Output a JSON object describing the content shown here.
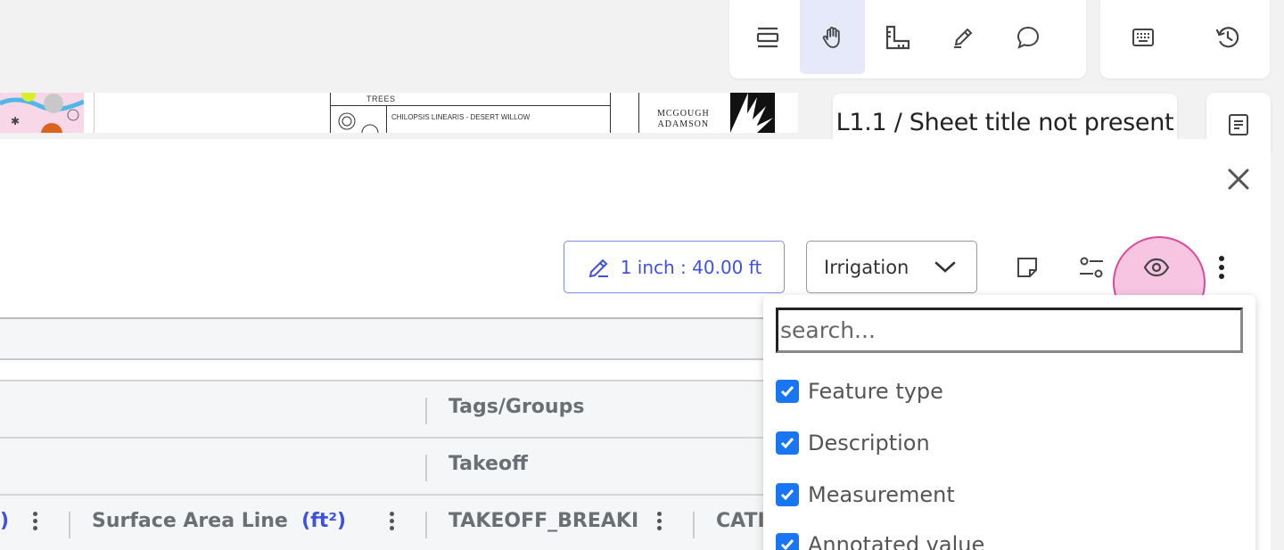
{
  "toolbar": {
    "tools": [
      {
        "name": "select-rows-icon",
        "active": false
      },
      {
        "name": "hand-pan-icon",
        "active": true
      },
      {
        "name": "ruler-measure-icon",
        "active": false
      },
      {
        "name": "pencil-icon",
        "active": false
      },
      {
        "name": "comment-bubble-icon",
        "active": false
      }
    ],
    "side_tools": [
      {
        "name": "keyboard-icon"
      },
      {
        "name": "history-icon"
      }
    ]
  },
  "drawing": {
    "legend_header": "TREES",
    "legend_item": "CHILOPSIS LINEARIS - DESERT WILLOW",
    "logo_line1": "MCGOUGH",
    "logo_line2": "ADAMSON"
  },
  "sheet": {
    "title": "L1.1 / Sheet title not present"
  },
  "controls": {
    "scale_label": "1 inch : 40.00 ft",
    "layer_value": "Irrigation",
    "accent": "#3f51e0"
  },
  "table": {
    "group_header": "Tags/Groups",
    "takeoff_header": "Takeoff",
    "columns": {
      "left_unit_fragment": ")",
      "surface_label": "Surface Area Line",
      "surface_unit": "(ft²)",
      "breakdown_label": "TAKEOFF_BREAKI",
      "cat_label": "CATI"
    }
  },
  "column_menu": {
    "search_placeholder": "search...",
    "options": [
      {
        "label": "Feature type",
        "checked": true
      },
      {
        "label": "Description",
        "checked": true
      },
      {
        "label": "Measurement",
        "checked": true
      },
      {
        "label": "Annotated value",
        "checked": true
      }
    ]
  }
}
